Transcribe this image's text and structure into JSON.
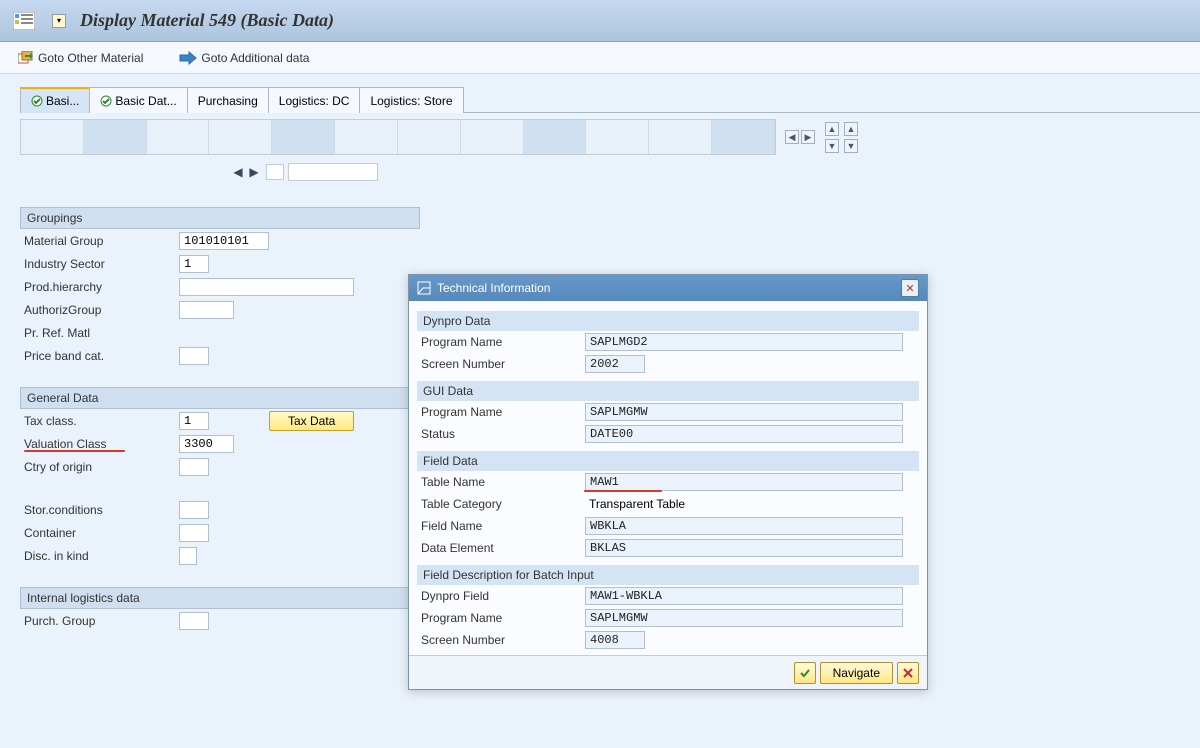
{
  "title": "Display Material 549 (Basic Data)",
  "toolbar": {
    "goto_other": "Goto Other Material",
    "goto_additional": "Goto Additional data"
  },
  "tabs": [
    {
      "label": "Basi...",
      "checked": true,
      "active": true
    },
    {
      "label": "Basic Dat...",
      "checked": true,
      "active": false
    },
    {
      "label": "Purchasing",
      "checked": false,
      "active": false
    },
    {
      "label": "Logistics: DC",
      "checked": false,
      "active": false
    },
    {
      "label": "Logistics: Store",
      "checked": false,
      "active": false
    }
  ],
  "groups": {
    "groupings": {
      "header": "Groupings",
      "material_group": {
        "label": "Material Group",
        "value": "101010101"
      },
      "industry_sector": {
        "label": "Industry Sector",
        "value": "1"
      },
      "prod_hierarchy": {
        "label": "Prod.hierarchy",
        "value": ""
      },
      "authoriz_group": {
        "label": "AuthorizGroup",
        "value": ""
      },
      "pr_ref_matl": {
        "label": "Pr. Ref. Matl",
        "value": ""
      },
      "price_band_cat": {
        "label": "Price band cat.",
        "value": ""
      }
    },
    "general": {
      "header": "General Data",
      "tax_class": {
        "label": "Tax class.",
        "value": "1"
      },
      "tax_data_btn": "Tax Data",
      "valuation_class": {
        "label": "Valuation Class",
        "value": "3300"
      },
      "ctry_origin": {
        "label": "Ctry of origin",
        "value": ""
      },
      "stor_conditions": {
        "label": "Stor.conditions",
        "value": ""
      },
      "container": {
        "label": "Container",
        "value": ""
      },
      "disc_in_kind": {
        "label": "Disc. in kind",
        "value": ""
      }
    },
    "logistics": {
      "header": "Internal logistics data",
      "purch_group": {
        "label": "Purch. Group",
        "value": ""
      }
    }
  },
  "dialog": {
    "title": "Technical Information",
    "dynpro": {
      "header": "Dynpro Data",
      "program_name": {
        "label": "Program Name",
        "value": "SAPLMGD2"
      },
      "screen_number": {
        "label": "Screen Number",
        "value": "2002"
      }
    },
    "gui": {
      "header": "GUI Data",
      "program_name": {
        "label": "Program Name",
        "value": "SAPLMGMW"
      },
      "status": {
        "label": "Status",
        "value": "DATE00"
      }
    },
    "field": {
      "header": "Field Data",
      "table_name": {
        "label": "Table Name",
        "value": "MAW1"
      },
      "table_category": {
        "label": "Table Category",
        "value": "Transparent Table"
      },
      "field_name": {
        "label": "Field Name",
        "value": "WBKLA"
      },
      "data_element": {
        "label": "Data Element",
        "value": "BKLAS"
      }
    },
    "batch": {
      "header": "Field Description for Batch Input",
      "dynpro_field": {
        "label": "Dynpro Field",
        "value": "MAW1-WBKLA"
      },
      "program_name": {
        "label": "Program Name",
        "value": "SAPLMGMW"
      },
      "screen_number": {
        "label": "Screen Number",
        "value": "4008"
      }
    },
    "navigate_btn": "Navigate"
  }
}
